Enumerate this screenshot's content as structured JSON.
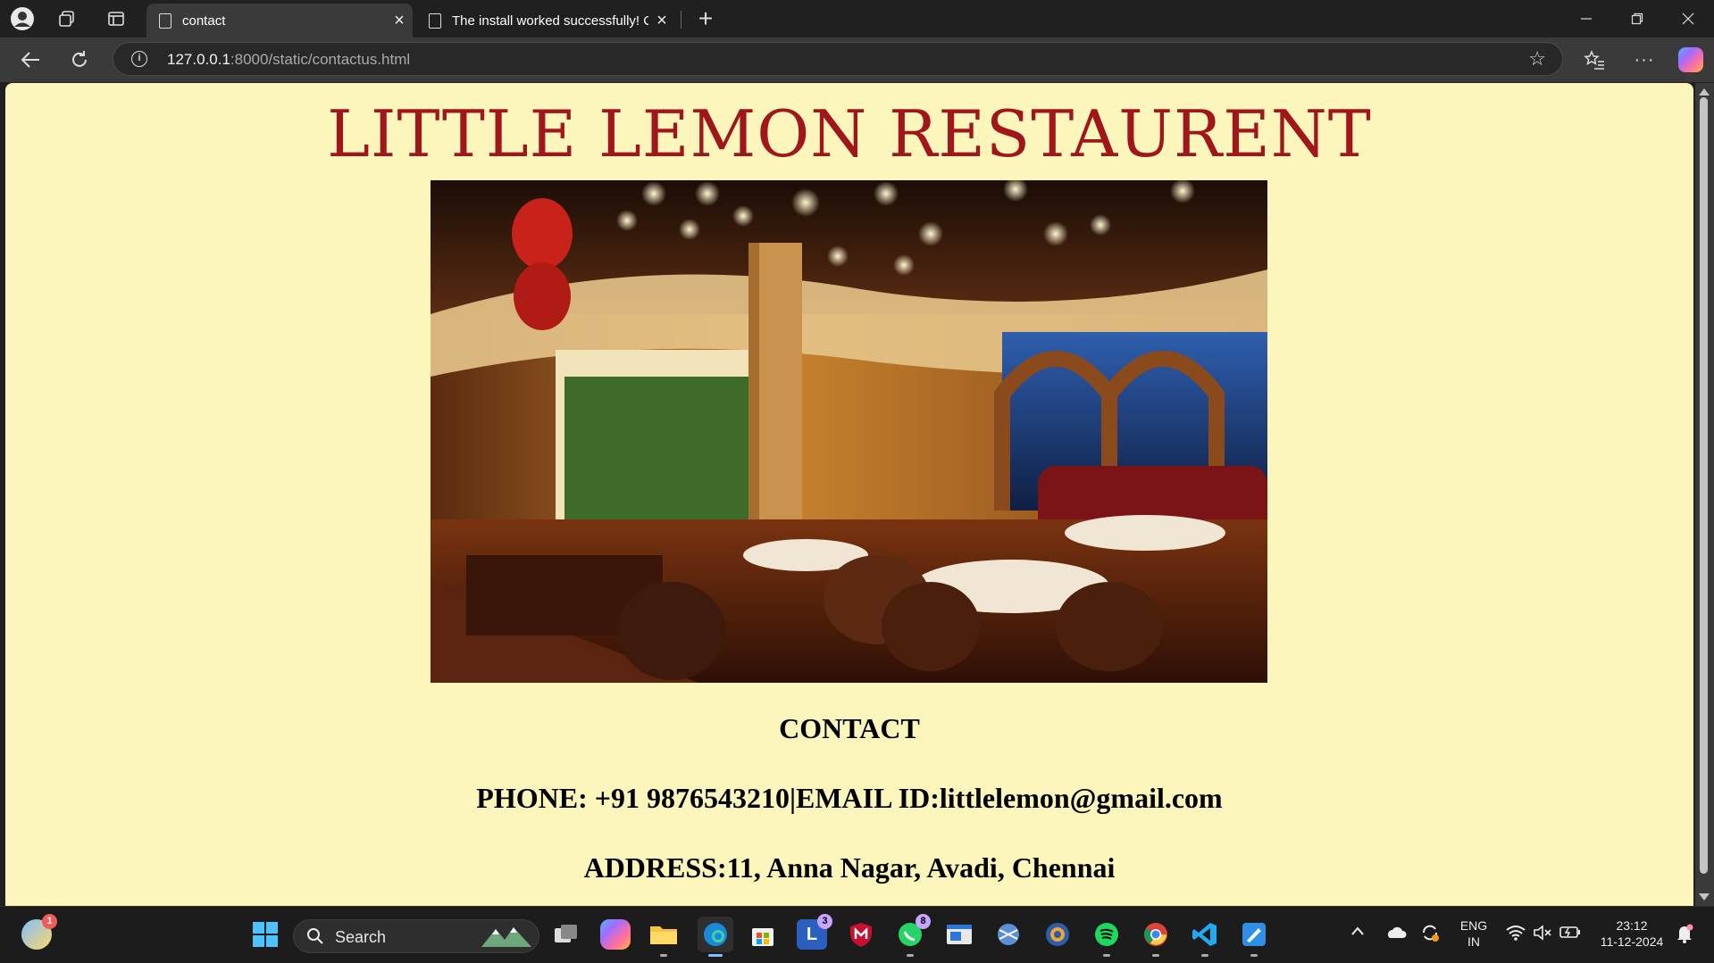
{
  "browser": {
    "tabs": [
      {
        "label": "contact",
        "active": true
      },
      {
        "label": "The install worked successfully! Co",
        "active": false
      }
    ],
    "url_host": "127.0.0.1",
    "url_rest": ":8000/static/contactus.html"
  },
  "page": {
    "heading": "LITTLE LEMON RESTAURENT",
    "contact_title": "CONTACT",
    "phone_email": "PHONE: +91 9876543210|EMAIL ID:littlelemon@gmail.com",
    "address": "ADDRESS:11, Anna Nagar, Avadi, Chennai",
    "bg_color": "#fcf6bd",
    "heading_color": "#a0161a"
  },
  "taskbar": {
    "search_label": "Search",
    "weather_badge": "1",
    "teams_badge": "3",
    "whatsapp_badge": "8",
    "lang_top": "ENG",
    "lang_bottom": "IN",
    "time": "23:12",
    "date": "11-12-2024"
  }
}
